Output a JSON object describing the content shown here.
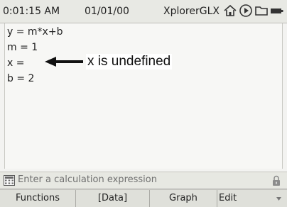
{
  "statusbar": {
    "time": "0:01:15 AM",
    "date": "01/01/00",
    "app_name": "XplorerGLX",
    "icons": [
      "home-icon",
      "play-icon",
      "folder-icon",
      "battery-icon"
    ]
  },
  "calculator": {
    "lines": [
      "y = m*x+b",
      "m = 1",
      "x =",
      "b = 2"
    ],
    "annotation": "x is undefined"
  },
  "input": {
    "placeholder": "Enter a calculation expression",
    "icons": [
      "keypad-icon",
      "lock-icon"
    ]
  },
  "softkeys": {
    "functions": "Functions",
    "data": "[Data]",
    "graph": "Graph",
    "edit": "Edit"
  },
  "colors": {
    "statusbar_bg": "#e8e9e4",
    "content_bg": "#f7f7f5",
    "softkey_bg": "#dfe0da"
  }
}
